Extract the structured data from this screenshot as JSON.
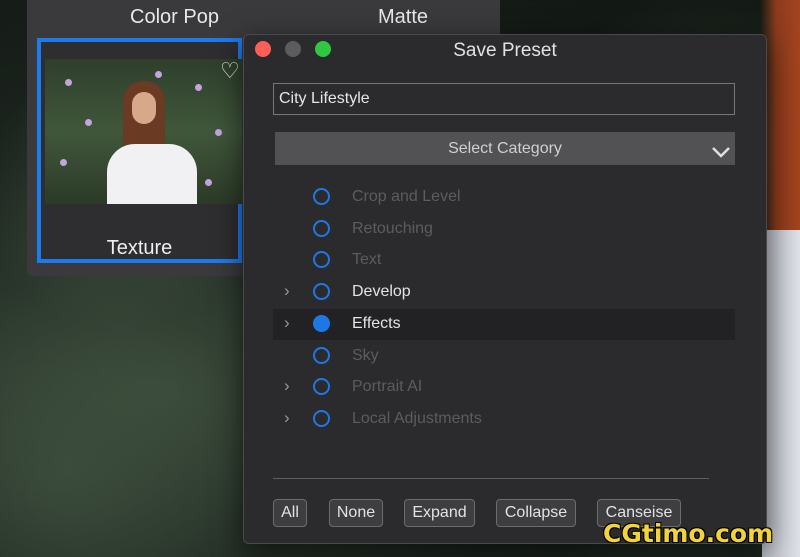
{
  "background_presets": {
    "top_labels": [
      "Color Pop",
      "Matte"
    ],
    "selected_preset": {
      "label": "Texture",
      "favorite_icon": "heart-outline-icon"
    }
  },
  "dialog": {
    "title": "Save Preset",
    "name_field": {
      "value": "City Lifestyle"
    },
    "category_select": {
      "label": "Select Category",
      "icon": "chevron-down-icon"
    },
    "categories": [
      {
        "label": "Crop and Level",
        "enabled": false,
        "expandable": false,
        "checked": false
      },
      {
        "label": "Retouching",
        "enabled": false,
        "expandable": false,
        "checked": false
      },
      {
        "label": "Text",
        "enabled": false,
        "expandable": false,
        "checked": false
      },
      {
        "label": "Develop",
        "enabled": true,
        "expandable": true,
        "checked": false
      },
      {
        "label": "Effects",
        "enabled": true,
        "expandable": true,
        "checked": true,
        "selected": true
      },
      {
        "label": "Sky",
        "enabled": false,
        "expandable": false,
        "checked": false
      },
      {
        "label": "Portrait AI",
        "enabled": false,
        "expandable": true,
        "checked": false
      },
      {
        "label": "Local Adjustments",
        "enabled": false,
        "expandable": true,
        "checked": false
      }
    ],
    "buttons": {
      "all": "All",
      "none": "None",
      "expand": "Expand",
      "collapse": "Collapse",
      "close": "Canseise"
    }
  },
  "watermark": "CGtimo.com",
  "colors": {
    "accent": "#1d78e6",
    "selection_border": "#1d7bf0",
    "dialog_bg": "#2b2b2d"
  }
}
